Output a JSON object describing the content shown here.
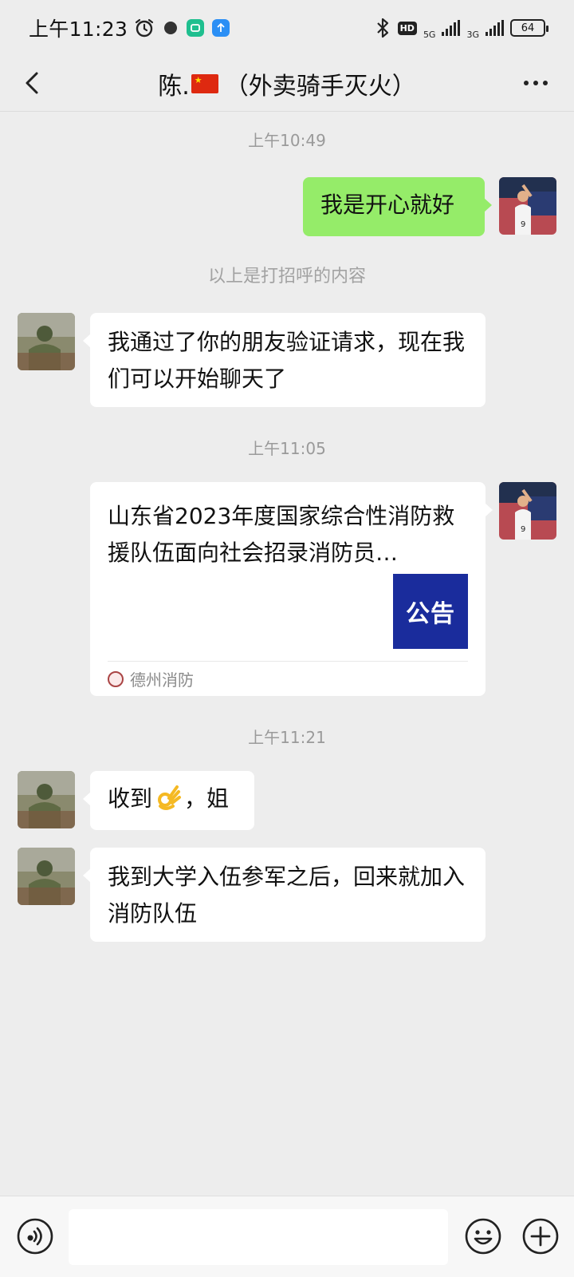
{
  "status_bar": {
    "time": "上午11:23",
    "network_1": "5G",
    "network_2": "3G",
    "hd": "HD",
    "battery": "64"
  },
  "header": {
    "name": "陈.",
    "subtitle": "（外卖骑手灭火）"
  },
  "messages": {
    "time_1": "上午10:49",
    "msg_me_1": "我是开心就好",
    "system_note": "以上是打招呼的内容",
    "msg_them_1": "我通过了你的朋友验证请求，现在我们可以开始聊天了",
    "time_2": "上午11:05",
    "card": {
      "title": "山东省2023年度国家综合性消防救援队伍面向社会招录消防员…",
      "thumb_text": "公告",
      "source": "德州消防"
    },
    "time_3": "上午11:21",
    "msg_them_2_part1": "收到",
    "msg_them_2_part2": "，姐",
    "msg_them_3": "我到大学入伍参军之后，回来就加入消防队伍"
  },
  "input_bar": {
    "value": "",
    "placeholder": ""
  },
  "colors": {
    "background": "#ededed",
    "my_bubble": "#95ec69",
    "their_bubble": "#ffffff",
    "card_thumb": "#1a2c9c"
  },
  "icons": [
    "alarm-icon",
    "dot-icon",
    "app-icon",
    "upload-icon",
    "bluetooth-icon",
    "signal-icon",
    "battery-icon",
    "back-icon",
    "more-icon",
    "ok-hand-emoji",
    "voice-icon",
    "emoji-icon",
    "plus-icon"
  ]
}
